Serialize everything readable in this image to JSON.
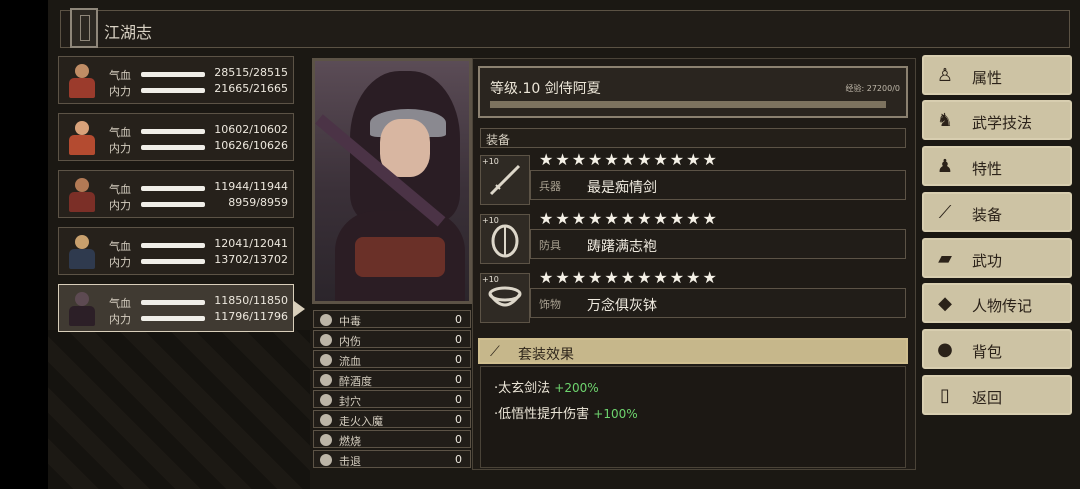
{
  "title": "江湖志",
  "team": [
    {
      "hp_label": "气血",
      "hp": "28515/28515",
      "mp_label": "内力",
      "mp": "21665/21665",
      "avatar": "warrior-red-icon"
    },
    {
      "hp_label": "气血",
      "hp": "10602/10602",
      "mp_label": "内力",
      "mp": "10626/10626",
      "avatar": "monk-red-icon"
    },
    {
      "hp_label": "气血",
      "hp": "11944/11944",
      "mp_label": "内力",
      "mp": "8959/8959",
      "avatar": "bearded-fighter-icon"
    },
    {
      "hp_label": "气血",
      "hp": "12041/12041",
      "mp_label": "内力",
      "mp": "13702/13702",
      "avatar": "hat-swordsman-icon"
    },
    {
      "hp_label": "气血",
      "hp": "11850/11850",
      "mp_label": "内力",
      "mp": "11796/11796",
      "avatar": "hooded-swordswoman-icon"
    }
  ],
  "debuffs": [
    {
      "name": "中毒",
      "value": "0",
      "icon": "skull-icon"
    },
    {
      "name": "内伤",
      "value": "0",
      "icon": "broken-heart-icon"
    },
    {
      "name": "流血",
      "value": "0",
      "icon": "blood-icon"
    },
    {
      "name": "醉酒度",
      "value": "0",
      "icon": "wine-icon"
    },
    {
      "name": "封穴",
      "value": "0",
      "icon": "needle-icon"
    },
    {
      "name": "走火入魔",
      "value": "0",
      "icon": "demon-icon"
    },
    {
      "name": "燃烧",
      "value": "0",
      "icon": "fire-icon"
    },
    {
      "name": "击退",
      "value": "0",
      "icon": "boot-icon"
    }
  ],
  "character": {
    "level_name": "等级.10 剑侍阿夏",
    "exp": "经验: 27200/0",
    "exp_progress": 1.0
  },
  "equipment": {
    "section_label": "装备",
    "items": [
      {
        "slot": "兵器",
        "name": "最是痴情剑",
        "enhance": "+10",
        "stars": 11,
        "icon": "sword-icon"
      },
      {
        "slot": "防具",
        "name": "踌躇满志袍",
        "enhance": "+10",
        "stars": 11,
        "icon": "armor-icon"
      },
      {
        "slot": "饰物",
        "name": "万念俱灰钵",
        "enhance": "+10",
        "stars": 11,
        "icon": "bowl-icon"
      }
    ]
  },
  "set": {
    "label": "套装效果",
    "effects": [
      {
        "text": "·太玄剑法",
        "bonus": "+200%"
      },
      {
        "text": "·低悟性提升伤害",
        "bonus": "+100%"
      }
    ]
  },
  "menu": [
    {
      "label": "属性",
      "icon": "person-icon"
    },
    {
      "label": "武学技法",
      "icon": "martial-figure-icon"
    },
    {
      "label": "特性",
      "icon": "trait-figure-icon"
    },
    {
      "label": "装备",
      "icon": "sword-icon"
    },
    {
      "label": "武功",
      "icon": "scroll-book-icon"
    },
    {
      "label": "人物传记",
      "icon": "diamond-icon"
    },
    {
      "label": "背包",
      "icon": "bag-icon"
    },
    {
      "label": "返回",
      "icon": "door-icon"
    }
  ]
}
